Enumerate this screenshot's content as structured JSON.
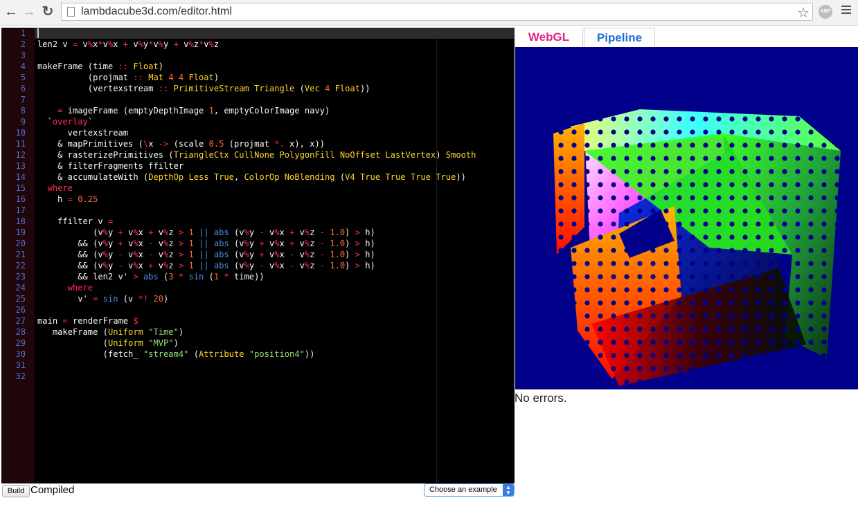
{
  "browser": {
    "url": "lambdacube3d.com/editor.html",
    "extension_badge": "ABP"
  },
  "editor": {
    "lines": [
      {
        "n": "1",
        "t": ""
      },
      {
        "n": "2",
        "t": "len2 v = v%x*v%x + v%y*v%y + v%z*v%z"
      },
      {
        "n": "3",
        "t": ""
      },
      {
        "n": "4",
        "t": "makeFrame (time :: Float)"
      },
      {
        "n": "5",
        "t": "          (projmat :: Mat 4 4 Float)"
      },
      {
        "n": "6",
        "t": "          (vertexstream :: PrimitiveStream Triangle (Vec 4 Float))"
      },
      {
        "n": "7",
        "t": ""
      },
      {
        "n": "8",
        "t": "    = imageFrame (emptyDepthImage 1, emptyColorImage navy)"
      },
      {
        "n": "9",
        "t": "  `overlay`"
      },
      {
        "n": "10",
        "t": "      vertexstream"
      },
      {
        "n": "11",
        "t": "    & mapPrimitives (\\x -> (scale 0.5 (projmat *. x), x))"
      },
      {
        "n": "12",
        "t": "    & rasterizePrimitives (TriangleCtx CullNone PolygonFill NoOffset LastVertex) Smooth"
      },
      {
        "n": "13",
        "t": "    & filterFragments ffilter"
      },
      {
        "n": "14",
        "t": "    & accumulateWith (DepthOp Less True, ColorOp NoBlending (V4 True True True True))"
      },
      {
        "n": "15",
        "t": "  where"
      },
      {
        "n": "16",
        "t": "    h = 0.25"
      },
      {
        "n": "17",
        "t": ""
      },
      {
        "n": "18",
        "t": "    ffilter v ="
      },
      {
        "n": "19",
        "t": "           (v%y + v%x + v%z > 1 || abs (v%y - v%x + v%z - 1.0) > h)"
      },
      {
        "n": "20",
        "t": "        && (v%y + v%x - v%z > 1 || abs (v%y + v%x + v%z - 1.0) > h)"
      },
      {
        "n": "21",
        "t": "        && (v%y - v%x - v%z > 1 || abs (v%y + v%x - v%z - 1.0) > h)"
      },
      {
        "n": "22",
        "t": "        && (v%y - v%x + v%z > 1 || abs (v%y - v%x - v%z - 1.0) > h)"
      },
      {
        "n": "23",
        "t": "        && len2 v' > abs (3 * sin (1 * time))"
      },
      {
        "n": "24",
        "t": "      where"
      },
      {
        "n": "25",
        "t": "        v' = sin (v *! 20)"
      },
      {
        "n": "26",
        "t": ""
      },
      {
        "n": "27",
        "t": "main = renderFrame $"
      },
      {
        "n": "28",
        "t": "   makeFrame (Uniform \"Time\")"
      },
      {
        "n": "29",
        "t": "             (Uniform \"MVP\")"
      },
      {
        "n": "30",
        "t": "             (fetch_ \"stream4\" (Attribute \"position4\"))"
      },
      {
        "n": "31",
        "t": ""
      },
      {
        "n": "32",
        "t": ""
      }
    ]
  },
  "toolbar": {
    "build_label": "Build",
    "status": "Compiled",
    "example_select": "Choose an example"
  },
  "tabs": {
    "webgl": "WebGL",
    "pipeline": "Pipeline"
  },
  "output": {
    "message": "No errors."
  },
  "colors": {
    "keyword": "#ffd52a",
    "operator": "#ff2d55",
    "number": "#fb6c35",
    "string": "#96e07a",
    "builtin": "#4b8fe5",
    "webgl_tab": "#e0207e",
    "pipeline_tab": "#1f6fd2",
    "canvas_bg": "#00008a"
  }
}
